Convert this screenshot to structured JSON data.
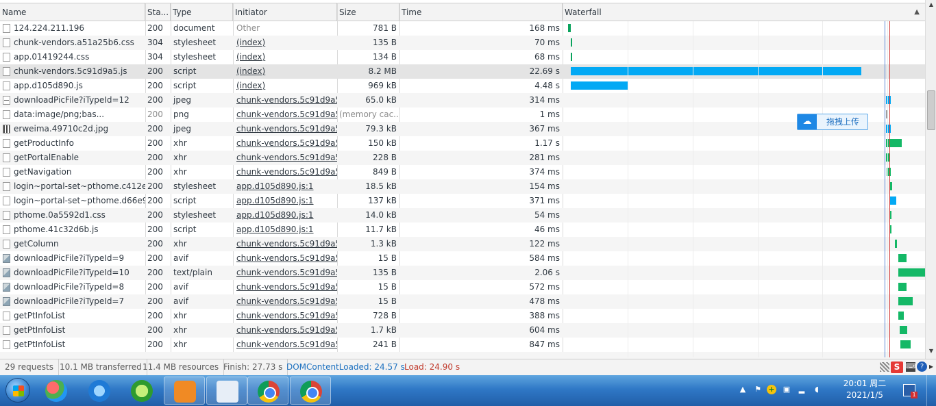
{
  "columns": {
    "name": "Name",
    "status": "Sta...",
    "type": "Type",
    "initiator": "Initiator",
    "size": "Size",
    "time": "Time",
    "waterfall": "Waterfall"
  },
  "requests": [
    {
      "name": "124.224.211.196",
      "status": "200",
      "type": "document",
      "initiator": "Other",
      "initiator_link": false,
      "size": "781 B",
      "time": "168 ms",
      "icon": "doc",
      "bar": {
        "start": 0.0,
        "end": 0.007,
        "color": "#0aa35d"
      }
    },
    {
      "name": "chunk-vendors.a51a25b6.css",
      "status": "304",
      "type": "stylesheet",
      "initiator": "(index)",
      "initiator_link": true,
      "size": "135 B",
      "time": "70 ms",
      "icon": "doc",
      "bar": {
        "start": 0.007,
        "end": 0.011,
        "color": "#0aa35d"
      }
    },
    {
      "name": "app.01419244.css",
      "status": "304",
      "type": "stylesheet",
      "initiator": "(index)",
      "initiator_link": true,
      "size": "134 B",
      "time": "68 ms",
      "icon": "doc",
      "bar": {
        "start": 0.007,
        "end": 0.011,
        "color": "#0aa35d"
      }
    },
    {
      "name": "chunk-vendors.5c91d9a5.js",
      "status": "200",
      "type": "script",
      "initiator": "(index)",
      "initiator_link": true,
      "size": "8.2 MB",
      "time": "22.69 s",
      "icon": "doc",
      "bar": {
        "start": 0.008,
        "end": 0.81,
        "color": "#03a9f4"
      }
    },
    {
      "name": "app.d105d890.js",
      "status": "200",
      "type": "script",
      "initiator": "(index)",
      "initiator_link": true,
      "size": "969 kB",
      "time": "4.48 s",
      "icon": "doc",
      "bar": {
        "start": 0.008,
        "end": 0.167,
        "color": "#03a9f4"
      }
    },
    {
      "name": "downloadPicFile?iTypeId=12",
      "status": "200",
      "type": "jpeg",
      "initiator": "chunk-vendors.5c91d9a5...",
      "initiator_link": true,
      "size": "65.0 kB",
      "time": "314 ms",
      "icon": "dash",
      "bar": {
        "start": 0.877,
        "end": 0.89,
        "color": "#03a9f4"
      }
    },
    {
      "name": "data:image/png;bas...",
      "status": "200",
      "type": "png",
      "initiator": "chunk-vendors.5c91d9a5...",
      "initiator_link": true,
      "size": "(memory cac...",
      "time": "1 ms",
      "icon": "doc",
      "muted": true,
      "bar": {
        "start": 0.877,
        "end": 0.879,
        "color": "#9e9e9e"
      }
    },
    {
      "name": "erweima.49710c2d.jpg",
      "status": "200",
      "type": "jpeg",
      "initiator": "chunk-vendors.5c91d9a5...",
      "initiator_link": true,
      "size": "79.3 kB",
      "time": "367 ms",
      "icon": "qr",
      "bar": {
        "start": 0.877,
        "end": 0.89,
        "color": "#03a9f4"
      }
    },
    {
      "name": "getProductInfo",
      "status": "200",
      "type": "xhr",
      "initiator": "chunk-vendors.5c91d9a5...",
      "initiator_link": true,
      "size": "150 kB",
      "time": "1.17 s",
      "icon": "doc",
      "bar": {
        "start": 0.877,
        "end": 0.92,
        "color": "#14b866"
      }
    },
    {
      "name": "getPortalEnable",
      "status": "200",
      "type": "xhr",
      "initiator": "chunk-vendors.5c91d9a5...",
      "initiator_link": true,
      "size": "228 B",
      "time": "281 ms",
      "icon": "doc",
      "bar": {
        "start": 0.877,
        "end": 0.887,
        "color": "#14b866"
      }
    },
    {
      "name": "getNavigation",
      "status": "200",
      "type": "xhr",
      "initiator": "chunk-vendors.5c91d9a5...",
      "initiator_link": true,
      "size": "849 B",
      "time": "374 ms",
      "icon": "doc",
      "bar": {
        "start": 0.879,
        "end": 0.891,
        "color": "#14b866"
      }
    },
    {
      "name": "login~portal-set~pthome.c412ed...",
      "status": "200",
      "type": "stylesheet",
      "initiator": "app.d105d890.js:1",
      "initiator_link": true,
      "size": "18.5 kB",
      "time": "154 ms",
      "icon": "doc",
      "bar": {
        "start": 0.889,
        "end": 0.895,
        "color": "#14b866"
      }
    },
    {
      "name": "login~portal-set~pthome.d66e9c...",
      "status": "200",
      "type": "script",
      "initiator": "app.d105d890.js:1",
      "initiator_link": true,
      "size": "137 kB",
      "time": "371 ms",
      "icon": "doc",
      "bar": {
        "start": 0.889,
        "end": 0.905,
        "color": "#03a9f4"
      }
    },
    {
      "name": "pthome.0a5592d1.css",
      "status": "200",
      "type": "stylesheet",
      "initiator": "app.d105d890.js:1",
      "initiator_link": true,
      "size": "14.0 kB",
      "time": "54 ms",
      "icon": "doc",
      "bar": {
        "start": 0.889,
        "end": 0.893,
        "color": "#14b866"
      }
    },
    {
      "name": "pthome.41c32d6b.js",
      "status": "200",
      "type": "script",
      "initiator": "app.d105d890.js:1",
      "initiator_link": true,
      "size": "11.7 kB",
      "time": "46 ms",
      "icon": "doc",
      "bar": {
        "start": 0.889,
        "end": 0.893,
        "color": "#14b866"
      }
    },
    {
      "name": "getColumn",
      "status": "200",
      "type": "xhr",
      "initiator": "chunk-vendors.5c91d9a5...",
      "initiator_link": true,
      "size": "1.3 kB",
      "time": "122 ms",
      "icon": "doc",
      "bar": {
        "start": 0.902,
        "end": 0.908,
        "color": "#14b866"
      }
    },
    {
      "name": "downloadPicFile?iTypeId=9",
      "status": "200",
      "type": "avif",
      "initiator": "chunk-vendors.5c91d9a5...",
      "initiator_link": true,
      "size": "15 B",
      "time": "584 ms",
      "icon": "img",
      "bar": {
        "start": 0.912,
        "end": 0.934,
        "color": "#14b866"
      }
    },
    {
      "name": "downloadPicFile?iTypeId=10",
      "status": "200",
      "type": "text/plain",
      "initiator": "chunk-vendors.5c91d9a5...",
      "initiator_link": true,
      "size": "135 B",
      "time": "2.06 s",
      "icon": "img",
      "bar": {
        "start": 0.912,
        "end": 0.988,
        "color": "#14b866"
      }
    },
    {
      "name": "downloadPicFile?iTypeId=8",
      "status": "200",
      "type": "avif",
      "initiator": "chunk-vendors.5c91d9a5...",
      "initiator_link": true,
      "size": "15 B",
      "time": "572 ms",
      "icon": "img",
      "bar": {
        "start": 0.912,
        "end": 0.934,
        "color": "#14b866"
      }
    },
    {
      "name": "downloadPicFile?iTypeId=7",
      "status": "200",
      "type": "avif",
      "initiator": "chunk-vendors.5c91d9a5...",
      "initiator_link": true,
      "size": "15 B",
      "time": "478 ms",
      "icon": "img",
      "bar": {
        "start": 0.912,
        "end": 0.95,
        "color": "#14b866"
      }
    },
    {
      "name": "getPtInfoList",
      "status": "200",
      "type": "xhr",
      "initiator": "chunk-vendors.5c91d9a5...",
      "initiator_link": true,
      "size": "728 B",
      "time": "388 ms",
      "icon": "doc",
      "bar": {
        "start": 0.912,
        "end": 0.926,
        "color": "#14b866"
      }
    },
    {
      "name": "getPtInfoList",
      "status": "200",
      "type": "xhr",
      "initiator": "chunk-vendors.5c91d9a5...",
      "initiator_link": true,
      "size": "1.7 kB",
      "time": "604 ms",
      "icon": "doc",
      "bar": {
        "start": 0.914,
        "end": 0.936,
        "color": "#14b866"
      }
    },
    {
      "name": "getPtInfoList",
      "status": "200",
      "type": "xhr",
      "initiator": "chunk-vendors.5c91d9a5...",
      "initiator_link": true,
      "size": "241 B",
      "time": "847 ms",
      "icon": "doc",
      "bar": {
        "start": 0.916,
        "end": 0.946,
        "color": "#14b866"
      }
    }
  ],
  "waterfall_markers": {
    "dom_content_loaded": 0.873,
    "load": 0.886
  },
  "upload_widget": {
    "label": "拖拽上传"
  },
  "summary": {
    "requests": "29 requests",
    "transferred": "10.1 MB transferred",
    "resources": "11.4 MB resources",
    "finish": "Finish: 27.73 s",
    "dom_content_loaded": "DOMContentLoaded: 24.57 s",
    "load": "Load: 24.90 s"
  },
  "taskbar": {
    "apps": [
      "ie-browser",
      "green-arrow-app",
      "butterfly-app",
      "orange-media-app",
      "paint-app",
      "chrome-browser",
      "chrome-browser-2"
    ],
    "clock_time": "20:01 周二",
    "clock_date": "2021/1/5",
    "notification_count": "1"
  },
  "colors": {
    "script_bar": "#03a9f4",
    "xhr_bar": "#14b866",
    "dcl_line": "#5a86d6",
    "load_line": "#d23b3b"
  }
}
